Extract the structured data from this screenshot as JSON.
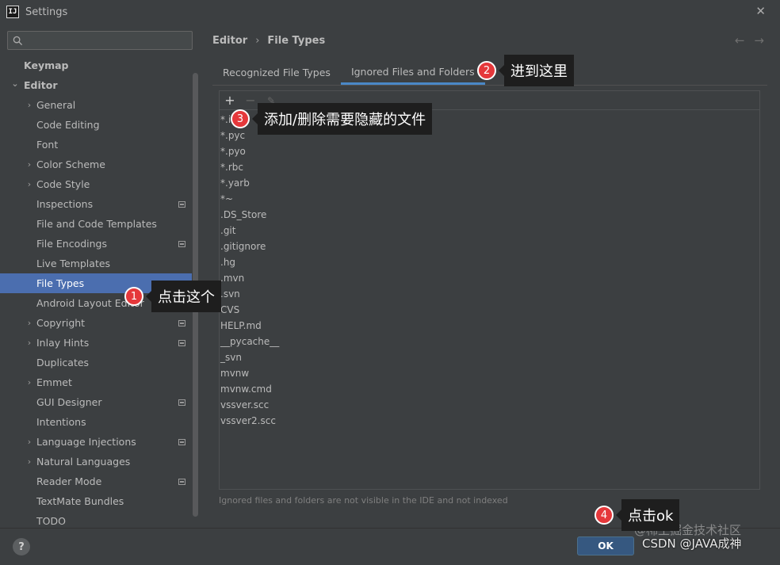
{
  "window": {
    "title": "Settings",
    "app_icon_text": "IJ",
    "close_glyph": "✕"
  },
  "search": {
    "placeholder": "",
    "value": ""
  },
  "sidebar": {
    "items": [
      {
        "label": "Keymap",
        "level": 0,
        "expandable": false,
        "bold": true,
        "module_icon": false
      },
      {
        "label": "Editor",
        "level": 0,
        "expandable": true,
        "expanded": true,
        "bold": true,
        "module_icon": false
      },
      {
        "label": "General",
        "level": 1,
        "expandable": true,
        "module_icon": false
      },
      {
        "label": "Code Editing",
        "level": 1,
        "expandable": false,
        "module_icon": false
      },
      {
        "label": "Font",
        "level": 1,
        "expandable": false,
        "module_icon": false
      },
      {
        "label": "Color Scheme",
        "level": 1,
        "expandable": true,
        "module_icon": false
      },
      {
        "label": "Code Style",
        "level": 1,
        "expandable": true,
        "module_icon": false
      },
      {
        "label": "Inspections",
        "level": 1,
        "expandable": false,
        "module_icon": true
      },
      {
        "label": "File and Code Templates",
        "level": 1,
        "expandable": false,
        "module_icon": false
      },
      {
        "label": "File Encodings",
        "level": 1,
        "expandable": false,
        "module_icon": true
      },
      {
        "label": "Live Templates",
        "level": 1,
        "expandable": false,
        "module_icon": false
      },
      {
        "label": "File Types",
        "level": 1,
        "expandable": false,
        "module_icon": false,
        "selected": true
      },
      {
        "label": "Android Layout Editor",
        "level": 1,
        "expandable": false,
        "module_icon": false
      },
      {
        "label": "Copyright",
        "level": 1,
        "expandable": true,
        "module_icon": true
      },
      {
        "label": "Inlay Hints",
        "level": 1,
        "expandable": true,
        "module_icon": true
      },
      {
        "label": "Duplicates",
        "level": 1,
        "expandable": false,
        "module_icon": false
      },
      {
        "label": "Emmet",
        "level": 1,
        "expandable": true,
        "module_icon": false
      },
      {
        "label": "GUI Designer",
        "level": 1,
        "expandable": false,
        "module_icon": true
      },
      {
        "label": "Intentions",
        "level": 1,
        "expandable": false,
        "module_icon": false
      },
      {
        "label": "Language Injections",
        "level": 1,
        "expandable": true,
        "module_icon": true
      },
      {
        "label": "Natural Languages",
        "level": 1,
        "expandable": true,
        "module_icon": false
      },
      {
        "label": "Reader Mode",
        "level": 1,
        "expandable": false,
        "module_icon": true
      },
      {
        "label": "TextMate Bundles",
        "level": 1,
        "expandable": false,
        "module_icon": false
      },
      {
        "label": "TODO",
        "level": 1,
        "expandable": false,
        "module_icon": false
      }
    ]
  },
  "breadcrumb": {
    "parent": "Editor",
    "separator": "›",
    "current": "File Types"
  },
  "nav": {
    "back": "←",
    "forward": "→"
  },
  "tabs": [
    {
      "label": "Recognized File Types",
      "active": false
    },
    {
      "label": "Ignored Files and Folders",
      "active": true
    }
  ],
  "toolbar": {
    "add": "+",
    "remove": "−",
    "edit": "✎"
  },
  "ignored_files": [
    "*.i",
    "*.pyc",
    "*.pyo",
    "*.rbc",
    "*.yarb",
    "*~",
    ".DS_Store",
    ".git",
    ".gitignore",
    ".hg",
    ".mvn",
    ".svn",
    "CVS",
    "HELP.md",
    "__pycache__",
    "_svn",
    "mvnw",
    "mvnw.cmd",
    "vssver.scc",
    "vssver2.scc"
  ],
  "hint": "Ignored files and folders are not visible in the IDE and not indexed",
  "bottom": {
    "help": "?",
    "ok": "OK"
  },
  "watermark": {
    "main": "CSDN @JAVA成神",
    "faint": "@稀土掘金技术社区"
  },
  "annotations": [
    {
      "num": "1",
      "text": "点击这个"
    },
    {
      "num": "2",
      "text": "进到这里"
    },
    {
      "num": "3",
      "text": "添加/删除需要隐藏的文件"
    },
    {
      "num": "4",
      "text": "点击ok"
    }
  ],
  "colors": {
    "background": "#3c3f41",
    "selection": "#4b6eaf",
    "accent_tab": "#4a88c7",
    "ok_button": "#365880",
    "badge": "#e5383b"
  }
}
